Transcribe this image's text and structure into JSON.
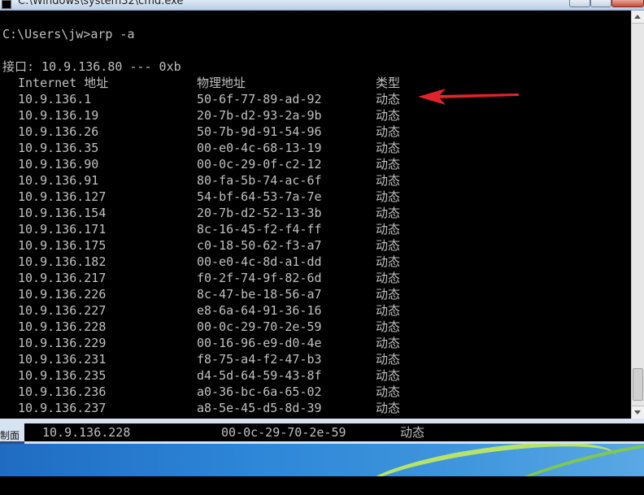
{
  "window": {
    "title": "C:\\Windows\\system32\\cmd.exe"
  },
  "console": {
    "prompt": "C:\\Users\\jw>arp -a",
    "interface_line": "接口: 10.9.136.80 --- 0xb",
    "headers": {
      "ip": "Internet 地址",
      "mac": "物理地址",
      "type": "类型"
    },
    "rows": [
      {
        "ip": "10.9.136.1",
        "mac": "50-6f-77-89-ad-92",
        "type": "动态"
      },
      {
        "ip": "10.9.136.19",
        "mac": "20-7b-d2-93-2a-9b",
        "type": "动态"
      },
      {
        "ip": "10.9.136.26",
        "mac": "50-7b-9d-91-54-96",
        "type": "动态"
      },
      {
        "ip": "10.9.136.35",
        "mac": "00-e0-4c-68-13-19",
        "type": "动态"
      },
      {
        "ip": "10.9.136.90",
        "mac": "00-0c-29-0f-c2-12",
        "type": "动态"
      },
      {
        "ip": "10.9.136.91",
        "mac": "80-fa-5b-74-ac-6f",
        "type": "动态"
      },
      {
        "ip": "10.9.136.127",
        "mac": "54-bf-64-53-7a-7e",
        "type": "动态"
      },
      {
        "ip": "10.9.136.154",
        "mac": "20-7b-d2-52-13-3b",
        "type": "动态"
      },
      {
        "ip": "10.9.136.171",
        "mac": "8c-16-45-f2-f4-ff",
        "type": "动态"
      },
      {
        "ip": "10.9.136.175",
        "mac": "c0-18-50-62-f3-a7",
        "type": "动态"
      },
      {
        "ip": "10.9.136.182",
        "mac": "00-e0-4c-8d-a1-dd",
        "type": "动态"
      },
      {
        "ip": "10.9.136.217",
        "mac": "f0-2f-74-9f-82-6d",
        "type": "动态"
      },
      {
        "ip": "10.9.136.226",
        "mac": "8c-47-be-18-56-a7",
        "type": "动态"
      },
      {
        "ip": "10.9.136.227",
        "mac": "e8-6a-64-91-36-16",
        "type": "动态"
      },
      {
        "ip": "10.9.136.228",
        "mac": "00-0c-29-70-2e-59",
        "type": "动态"
      },
      {
        "ip": "10.9.136.229",
        "mac": "00-16-96-e9-d0-4e",
        "type": "动态"
      },
      {
        "ip": "10.9.136.231",
        "mac": "f8-75-a4-f2-47-b3",
        "type": "动态"
      },
      {
        "ip": "10.9.136.235",
        "mac": "d4-5d-64-59-43-8f",
        "type": "动态"
      },
      {
        "ip": "10.9.136.236",
        "mac": "a0-36-bc-6a-65-02",
        "type": "动态"
      },
      {
        "ip": "10.9.136.237",
        "mac": "a8-5e-45-d5-8d-39",
        "type": "动态"
      }
    ]
  },
  "bottom_window": {
    "side_label": "制面",
    "row": {
      "ip": "10.9.136.228",
      "mac": "00-0c-29-70-2e-59",
      "type": "动态"
    }
  },
  "colors": {
    "console_bg": "#000000",
    "console_fg": "#c0c0c0",
    "annotation_arrow": "#e0242c"
  },
  "icons": {
    "title_icon": "cmd-icon",
    "annotation": "red-arrow-icon"
  }
}
